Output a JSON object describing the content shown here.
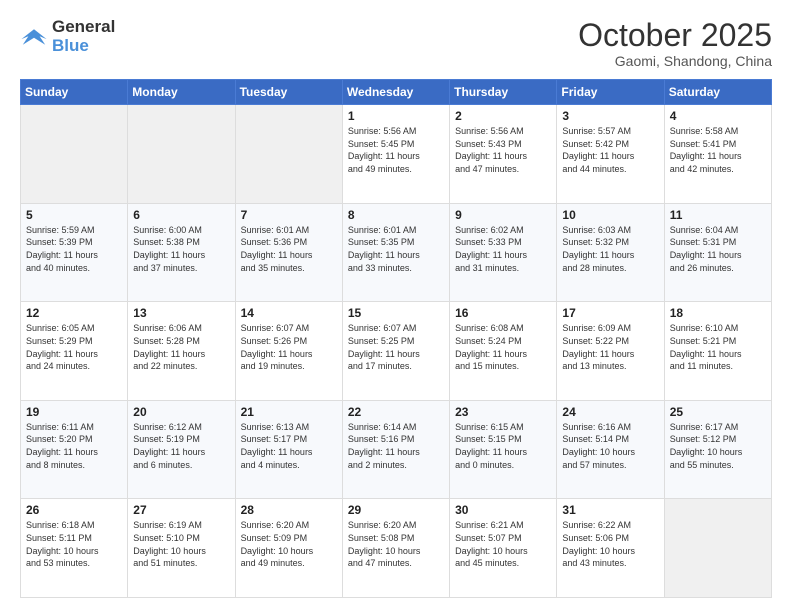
{
  "header": {
    "logo_line1": "General",
    "logo_line2": "Blue",
    "month": "October 2025",
    "location": "Gaomi, Shandong, China"
  },
  "weekdays": [
    "Sunday",
    "Monday",
    "Tuesday",
    "Wednesday",
    "Thursday",
    "Friday",
    "Saturday"
  ],
  "weeks": [
    [
      {
        "day": "",
        "info": ""
      },
      {
        "day": "",
        "info": ""
      },
      {
        "day": "",
        "info": ""
      },
      {
        "day": "1",
        "info": "Sunrise: 5:56 AM\nSunset: 5:45 PM\nDaylight: 11 hours\nand 49 minutes."
      },
      {
        "day": "2",
        "info": "Sunrise: 5:56 AM\nSunset: 5:43 PM\nDaylight: 11 hours\nand 47 minutes."
      },
      {
        "day": "3",
        "info": "Sunrise: 5:57 AM\nSunset: 5:42 PM\nDaylight: 11 hours\nand 44 minutes."
      },
      {
        "day": "4",
        "info": "Sunrise: 5:58 AM\nSunset: 5:41 PM\nDaylight: 11 hours\nand 42 minutes."
      }
    ],
    [
      {
        "day": "5",
        "info": "Sunrise: 5:59 AM\nSunset: 5:39 PM\nDaylight: 11 hours\nand 40 minutes."
      },
      {
        "day": "6",
        "info": "Sunrise: 6:00 AM\nSunset: 5:38 PM\nDaylight: 11 hours\nand 37 minutes."
      },
      {
        "day": "7",
        "info": "Sunrise: 6:01 AM\nSunset: 5:36 PM\nDaylight: 11 hours\nand 35 minutes."
      },
      {
        "day": "8",
        "info": "Sunrise: 6:01 AM\nSunset: 5:35 PM\nDaylight: 11 hours\nand 33 minutes."
      },
      {
        "day": "9",
        "info": "Sunrise: 6:02 AM\nSunset: 5:33 PM\nDaylight: 11 hours\nand 31 minutes."
      },
      {
        "day": "10",
        "info": "Sunrise: 6:03 AM\nSunset: 5:32 PM\nDaylight: 11 hours\nand 28 minutes."
      },
      {
        "day": "11",
        "info": "Sunrise: 6:04 AM\nSunset: 5:31 PM\nDaylight: 11 hours\nand 26 minutes."
      }
    ],
    [
      {
        "day": "12",
        "info": "Sunrise: 6:05 AM\nSunset: 5:29 PM\nDaylight: 11 hours\nand 24 minutes."
      },
      {
        "day": "13",
        "info": "Sunrise: 6:06 AM\nSunset: 5:28 PM\nDaylight: 11 hours\nand 22 minutes."
      },
      {
        "day": "14",
        "info": "Sunrise: 6:07 AM\nSunset: 5:26 PM\nDaylight: 11 hours\nand 19 minutes."
      },
      {
        "day": "15",
        "info": "Sunrise: 6:07 AM\nSunset: 5:25 PM\nDaylight: 11 hours\nand 17 minutes."
      },
      {
        "day": "16",
        "info": "Sunrise: 6:08 AM\nSunset: 5:24 PM\nDaylight: 11 hours\nand 15 minutes."
      },
      {
        "day": "17",
        "info": "Sunrise: 6:09 AM\nSunset: 5:22 PM\nDaylight: 11 hours\nand 13 minutes."
      },
      {
        "day": "18",
        "info": "Sunrise: 6:10 AM\nSunset: 5:21 PM\nDaylight: 11 hours\nand 11 minutes."
      }
    ],
    [
      {
        "day": "19",
        "info": "Sunrise: 6:11 AM\nSunset: 5:20 PM\nDaylight: 11 hours\nand 8 minutes."
      },
      {
        "day": "20",
        "info": "Sunrise: 6:12 AM\nSunset: 5:19 PM\nDaylight: 11 hours\nand 6 minutes."
      },
      {
        "day": "21",
        "info": "Sunrise: 6:13 AM\nSunset: 5:17 PM\nDaylight: 11 hours\nand 4 minutes."
      },
      {
        "day": "22",
        "info": "Sunrise: 6:14 AM\nSunset: 5:16 PM\nDaylight: 11 hours\nand 2 minutes."
      },
      {
        "day": "23",
        "info": "Sunrise: 6:15 AM\nSunset: 5:15 PM\nDaylight: 11 hours\nand 0 minutes."
      },
      {
        "day": "24",
        "info": "Sunrise: 6:16 AM\nSunset: 5:14 PM\nDaylight: 10 hours\nand 57 minutes."
      },
      {
        "day": "25",
        "info": "Sunrise: 6:17 AM\nSunset: 5:12 PM\nDaylight: 10 hours\nand 55 minutes."
      }
    ],
    [
      {
        "day": "26",
        "info": "Sunrise: 6:18 AM\nSunset: 5:11 PM\nDaylight: 10 hours\nand 53 minutes."
      },
      {
        "day": "27",
        "info": "Sunrise: 6:19 AM\nSunset: 5:10 PM\nDaylight: 10 hours\nand 51 minutes."
      },
      {
        "day": "28",
        "info": "Sunrise: 6:20 AM\nSunset: 5:09 PM\nDaylight: 10 hours\nand 49 minutes."
      },
      {
        "day": "29",
        "info": "Sunrise: 6:20 AM\nSunset: 5:08 PM\nDaylight: 10 hours\nand 47 minutes."
      },
      {
        "day": "30",
        "info": "Sunrise: 6:21 AM\nSunset: 5:07 PM\nDaylight: 10 hours\nand 45 minutes."
      },
      {
        "day": "31",
        "info": "Sunrise: 6:22 AM\nSunset: 5:06 PM\nDaylight: 10 hours\nand 43 minutes."
      },
      {
        "day": "",
        "info": ""
      }
    ]
  ]
}
